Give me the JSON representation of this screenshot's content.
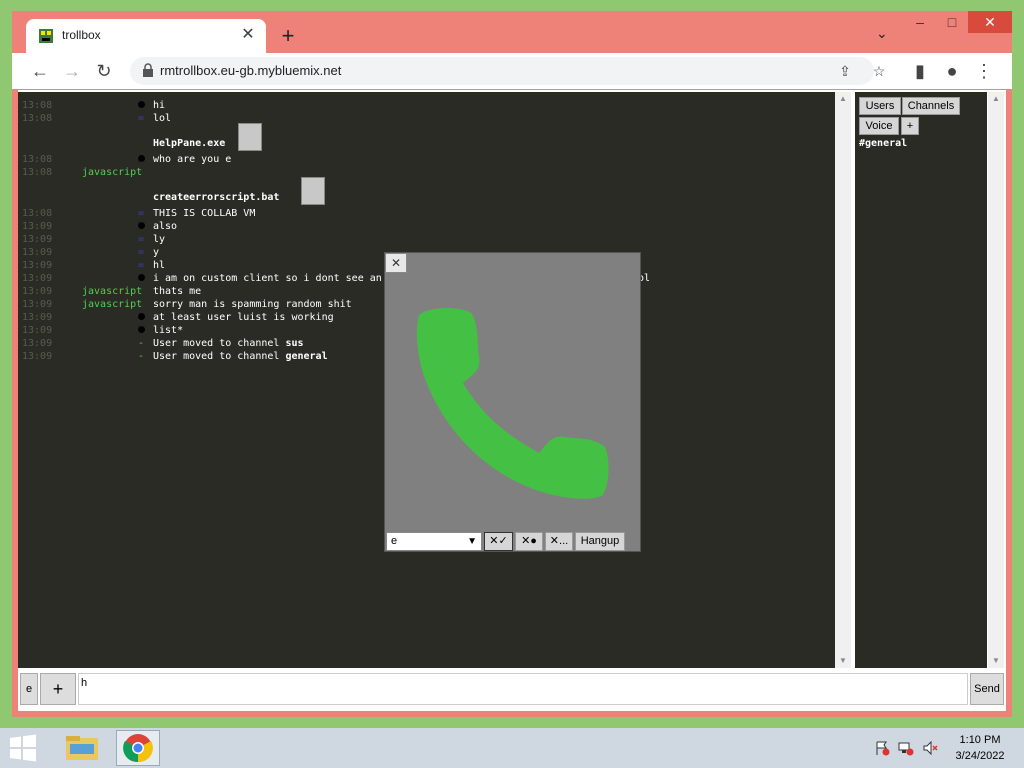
{
  "browser": {
    "tab_title": "trollbox",
    "tab_close": "✕",
    "new_tab": "+",
    "tab_search": "⌄",
    "url": "rmtrollbox.eu-gb.mybluemix.net",
    "window_buttons": {
      "minimize": "–",
      "maximize": "□",
      "close": "✕"
    }
  },
  "chat": {
    "messages": [
      {
        "time": "13:08",
        "nick": "",
        "mark": "dot",
        "text": "hi"
      },
      {
        "time": "13:08",
        "nick": "",
        "mark": "eq",
        "text": "lol"
      },
      {
        "time": "13:08",
        "nick": "",
        "mark": "dot",
        "text": "who are you e"
      },
      {
        "time": "13:08",
        "nick": "javascript",
        "mark": "",
        "text": ""
      },
      {
        "time": "13:08",
        "nick": "",
        "mark": "eq",
        "text": "THIS IS COLLAB VM"
      },
      {
        "time": "13:09",
        "nick": "",
        "mark": "dot",
        "text": "also"
      },
      {
        "time": "13:09",
        "nick": "",
        "mark": "eq",
        "text": "ly"
      },
      {
        "time": "13:09",
        "nick": "",
        "mark": "eq",
        "text": "y"
      },
      {
        "time": "13:09",
        "nick": "",
        "mark": "eq",
        "text": "hl"
      },
      {
        "time": "13:09",
        "nick": "",
        "mark": "dot",
        "text": "i am on custom client so i dont see an",
        "tail": "ol"
      },
      {
        "time": "13:09",
        "nick": "javascript",
        "mark": "",
        "text": "thats me"
      },
      {
        "time": "13:09",
        "nick": "javascript",
        "mark": "",
        "text": "sorry man is spamming random shit"
      },
      {
        "time": "13:09",
        "nick": "",
        "mark": "dot",
        "text": "at least user luist is working"
      },
      {
        "time": "13:09",
        "nick": "",
        "mark": "dot",
        "text": "list*"
      },
      {
        "time": "13:09",
        "nick": "",
        "mark": "dash",
        "text": "User  moved to channel ",
        "bold": "sus"
      },
      {
        "time": "13:09",
        "nick": "",
        "mark": "dash",
        "text": "User  moved to channel ",
        "bold": "general"
      }
    ],
    "files": [
      "HelpPane.exe",
      "createerrorscript.bat"
    ]
  },
  "sidebar": {
    "users_label": "Users",
    "channels_label": "Channels",
    "voice_label": "Voice",
    "plus_label": "+",
    "channel": "#general"
  },
  "call": {
    "close_label": "✕",
    "device_value": "e",
    "btn1": "✕✓",
    "btn2": "✕●",
    "btn3": "✕...",
    "hangup_label": "Hangup",
    "phone_color": "#44c044"
  },
  "input": {
    "select_value": "e",
    "plus_label": "+",
    "value": "h",
    "send_label": "Send"
  },
  "taskbar": {
    "time": "1:10 PM",
    "date": "3/24/2022"
  }
}
